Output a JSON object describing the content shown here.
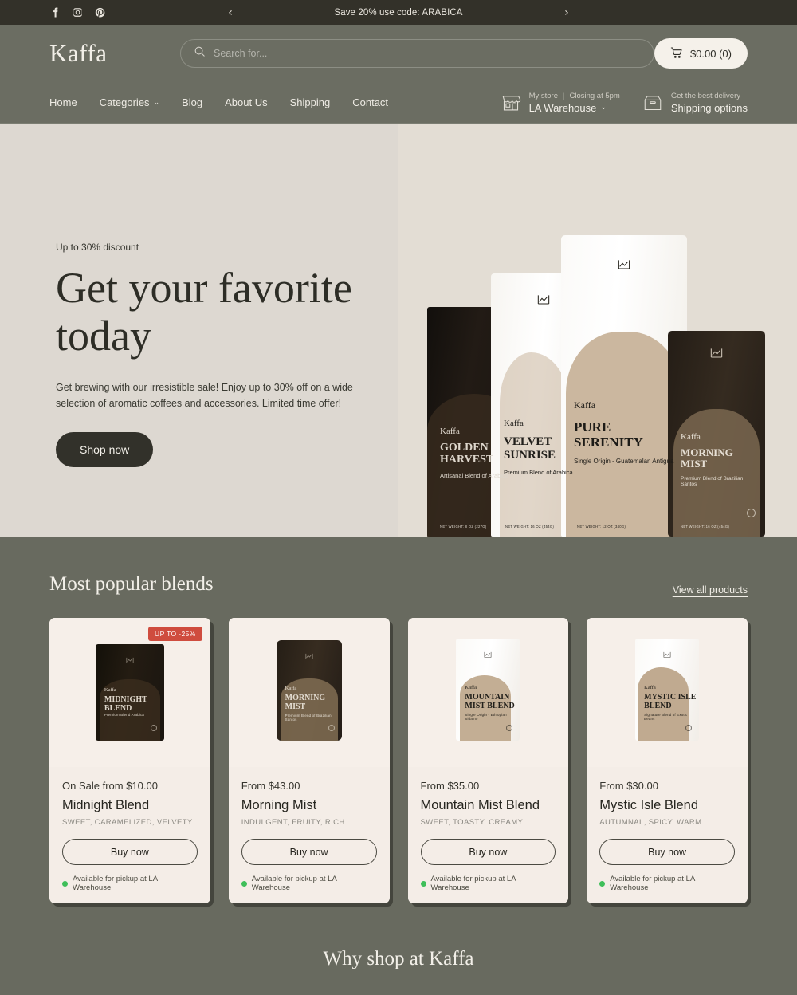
{
  "announcement": {
    "socials": [
      {
        "name": "facebook-icon",
        "label": "Facebook"
      },
      {
        "name": "instagram-icon",
        "label": "Instagram"
      },
      {
        "name": "pinterest-icon",
        "label": "Pinterest"
      }
    ],
    "message": "Save 20% use code: ARABICA",
    "prev_arrow": "‹",
    "next_arrow": "›"
  },
  "header": {
    "brand": "Kaffa",
    "search_placeholder": "Search for...",
    "search_value": "",
    "search_icon": "search-icon",
    "cart_icon": "cart-icon",
    "cart_label": "$0.00 (0)"
  },
  "nav": {
    "links": [
      {
        "label": "Home",
        "has_caret": false
      },
      {
        "label": "Categories",
        "has_caret": true
      },
      {
        "label": "Blog",
        "has_caret": false
      },
      {
        "label": "About Us",
        "has_caret": false
      },
      {
        "label": "Shipping",
        "has_caret": false
      },
      {
        "label": "Contact",
        "has_caret": false
      }
    ],
    "caret": "⌄",
    "store": {
      "icon": "storefront-icon",
      "top_left": "My store",
      "separator": "|",
      "top_right": "Closing at 5pm",
      "main": "LA Warehouse",
      "caret": "⌄"
    },
    "delivery": {
      "icon": "box-icon",
      "top": "Get the best delivery",
      "main": "Shipping options"
    }
  },
  "hero": {
    "eyebrow": "Up to 30% discount",
    "title": "Get your favorite today",
    "description": "Get brewing with our irresistible sale! Enjoy up to 30% off on a wide selection of aromatic coffees and accessories. Limited time offer!",
    "button": "Shop now",
    "bags": [
      {
        "id": "bag-golden",
        "brand": "Kaffa",
        "name": "GOLDEN HARVEST",
        "subtitle": "Artisanal Blend of Arabica",
        "net_weight": "NET WEIGHT: 8 OZ (227G)"
      },
      {
        "id": "bag-velvet",
        "brand": "Kaffa",
        "name": "VELVET SUNRISE",
        "subtitle": "Premium Blend of Arabica",
        "net_weight": "NET WEIGHT: 16 OZ (454G)"
      },
      {
        "id": "bag-pure",
        "brand": "Kaffa",
        "name": "PURE SERENITY",
        "subtitle": "Single Origin - Guatemalan Antigua",
        "net_weight": "NET WEIGHT: 12 OZ (340G)"
      },
      {
        "id": "bag-morning",
        "brand": "Kaffa",
        "name": "MORNING MIST",
        "subtitle": "Premium Blend of Brazilian Santos",
        "net_weight": "NET WEIGHT: 16 OZ (454G)"
      }
    ]
  },
  "products": {
    "section_title": "Most popular blends",
    "view_all": "View all products",
    "buy_label": "Buy now",
    "pickup_text": "Available for pickup at LA Warehouse",
    "items": [
      {
        "badge": "UP TO -25%",
        "price": "On Sale from $10.00",
        "name": "Midnight Blend",
        "notes": "SWEET, CARAMELIZED, VELVETY",
        "bag_brand": "Kaffa",
        "bag_name": "MIDNIGHT BLEND",
        "bag_sub": "Premium Blend Arabica"
      },
      {
        "badge": "",
        "price": "From $43.00",
        "name": "Morning Mist",
        "notes": "INDULGENT, FRUITY, RICH",
        "bag_brand": "Kaffa",
        "bag_name": "MORNING MIST",
        "bag_sub": "Premium Blend of Brazilian Santos"
      },
      {
        "badge": "",
        "price": "From $35.00",
        "name": "Mountain Mist Blend",
        "notes": "SWEET, TOASTY, CREAMY",
        "bag_brand": "Kaffa",
        "bag_name": "MOUNTAIN MIST BLEND",
        "bag_sub": "Single Origin - Ethiopian Sidamo"
      },
      {
        "badge": "",
        "price": "From $30.00",
        "name": "Mystic Isle Blend",
        "notes": "AUTUMNAL, SPICY, WARM",
        "bag_brand": "Kaffa",
        "bag_name": "MYSTIC ISLE BLEND",
        "bag_sub": "Signature Blend of Exotic Beans"
      }
    ]
  },
  "why": {
    "title": "Why shop at Kaffa"
  },
  "colors": {
    "announcement_bg": "#333129",
    "header_bg": "#6b6d62",
    "olive_bg": "#686a5f",
    "hero_left_bg": "#ddd8d1",
    "hero_right_bg": "#e3ddd4",
    "card_bg": "#f4ede7",
    "sale_badge": "#cf4c3e",
    "pickup_dot": "#3fbf5a",
    "dark_button": "#32312a"
  }
}
